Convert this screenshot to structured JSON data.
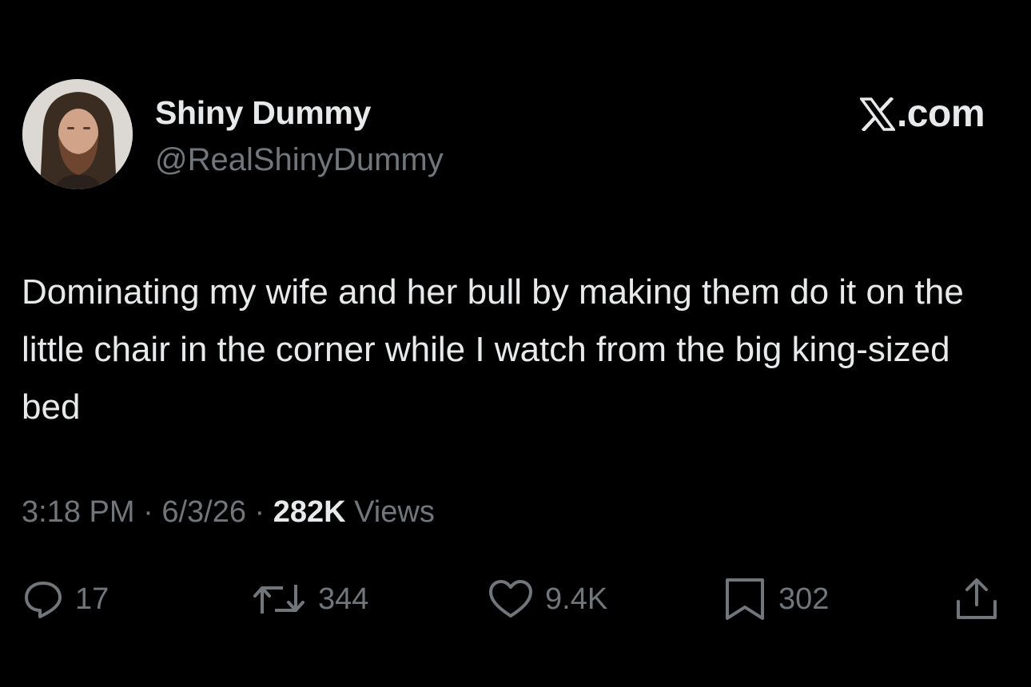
{
  "author": {
    "display_name": "Shiny Dummy",
    "handle": "@RealShinyDummy"
  },
  "brand": {
    "icon": "x-logo-icon",
    "text": ".com"
  },
  "tweet": {
    "text": "Dominating my wife and her bull by making them do it on the little chair in the corner while I watch from the big king-sized bed"
  },
  "meta": {
    "time": "3:18 PM",
    "sep1": " · ",
    "date": "6/3/26",
    "sep2": " · ",
    "views_count": "282K",
    "views_label": " Views"
  },
  "actions": {
    "reply": {
      "icon": "reply-icon",
      "count": "17"
    },
    "retweet": {
      "icon": "retweet-icon",
      "count": "344"
    },
    "like": {
      "icon": "heart-icon",
      "count": "9.4K"
    },
    "bookmark": {
      "icon": "bookmark-icon",
      "count": "302"
    },
    "share": {
      "icon": "share-icon"
    }
  },
  "colors": {
    "background": "#000000",
    "primary_text": "#e7e9ea",
    "secondary_text": "#71767b"
  }
}
